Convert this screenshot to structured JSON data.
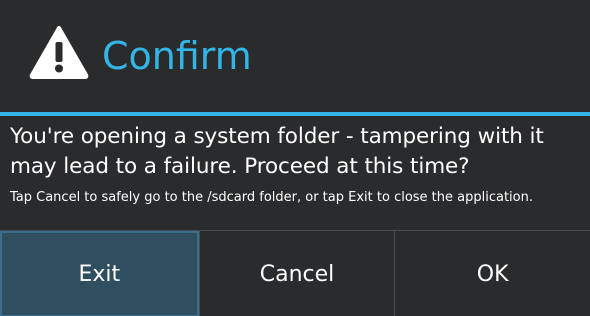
{
  "dialog": {
    "title": "Confirm",
    "icon": "warning-icon",
    "accent_color": "#33b5e5",
    "message": "You're opening a system folder - tampering with it may lead to a failure. Proceed at this time?",
    "hint": "Tap Cancel to safely go to the /sdcard folder, or tap Exit to close the application.",
    "buttons": {
      "exit": "Exit",
      "cancel": "Cancel",
      "ok": "OK"
    }
  }
}
